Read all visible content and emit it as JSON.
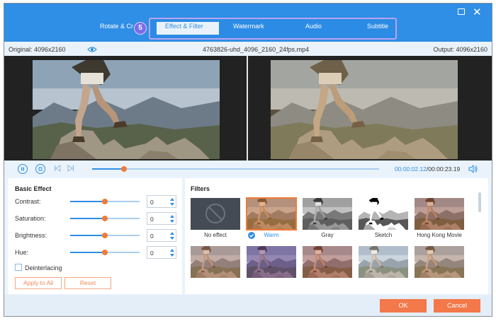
{
  "window": {
    "maximize_icon": "maximize-icon",
    "close_glyph": "✕"
  },
  "tabs": {
    "rotate_crop": "Rotate & Cr",
    "effect_filter": "Effect & Filter",
    "watermark": "Watermark",
    "audio": "Audio",
    "subtitle": "Subtitle",
    "step_badge": "5"
  },
  "info": {
    "original": "Original: 4096x2160",
    "filename": "4763826-uhd_4096_2160_24fps.mp4",
    "output": "Output: 4096x2160"
  },
  "player": {
    "current_time": "00:00:02.12",
    "separator": "/",
    "total_time": "00:00:23.19",
    "progress": 0.11
  },
  "basic_effect": {
    "title": "Basic Effect",
    "rows": [
      {
        "label": "Contrast:",
        "value": "0",
        "level": 0.5
      },
      {
        "label": "Saturation:",
        "value": "0",
        "level": 0.5
      },
      {
        "label": "Brightness:",
        "value": "0",
        "level": 0.5
      },
      {
        "label": "Hue:",
        "value": "0",
        "level": 0.5
      }
    ],
    "deinterlacing": "Deinterlacing",
    "apply_all": "Apply to All",
    "reset": "Reset"
  },
  "filters": {
    "title": "Filters",
    "items": [
      {
        "label": "No effect",
        "selected": false
      },
      {
        "label": "Warm",
        "selected": true
      },
      {
        "label": "Gray",
        "selected": false
      },
      {
        "label": "Sketch",
        "selected": false
      },
      {
        "label": "Hong Kong Movie",
        "selected": false
      }
    ]
  },
  "footer": {
    "ok": "OK",
    "cancel": "Cancel"
  },
  "colors": {
    "accent": "#2f8ee5",
    "orange": "#f3784a",
    "badge": "#7b6de9"
  }
}
